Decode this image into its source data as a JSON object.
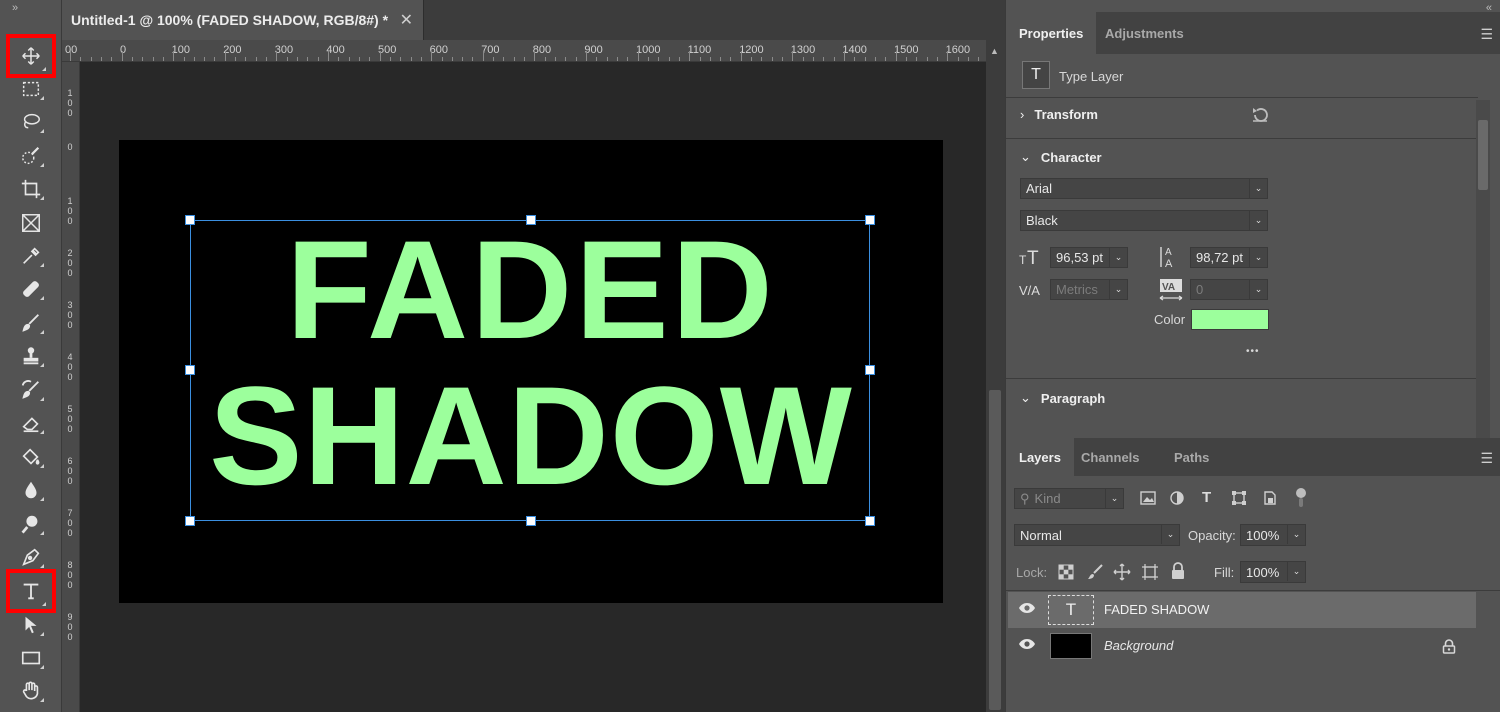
{
  "document": {
    "tab_title": "Untitled-1 @ 100% (FADED SHADOW, RGB/8#) *",
    "close_glyph": "✕",
    "ruler_top": [
      "00",
      "0",
      "100",
      "200",
      "300",
      "400",
      "500",
      "600",
      "700",
      "800",
      "900",
      "1000",
      "1100",
      "1200",
      "1300",
      "1400",
      "1500",
      "1600"
    ],
    "ruler_left": [
      "1 0 0",
      "0",
      "1 0 0",
      "2 0 0",
      "3 0 0",
      "4 0 0",
      "5 0 0",
      "6 0 0",
      "7 0 0",
      "8 0 0",
      "9 0 0"
    ],
    "text_line1": "FADED",
    "text_line2": "SHADOW",
    "text_color": "#9cff9c",
    "selection_color": "#3b8fe0"
  },
  "toolbar": {
    "collapse": "»",
    "highlight_color": "#ff0000",
    "tools": [
      {
        "name": "move-tool",
        "icon": "move-icon",
        "highlighted": true
      },
      {
        "name": "marquee-tool",
        "icon": "marquee-icon"
      },
      {
        "name": "lasso-tool",
        "icon": "lasso-icon"
      },
      {
        "name": "quick-selection-tool",
        "icon": "quick-selection-icon"
      },
      {
        "name": "crop-tool",
        "icon": "crop-icon"
      },
      {
        "name": "frame-tool",
        "icon": "frame-icon"
      },
      {
        "name": "eyedropper-tool",
        "icon": "eyedropper-icon"
      },
      {
        "name": "healing-tool",
        "icon": "bandage-icon"
      },
      {
        "name": "brush-tool",
        "icon": "brush-icon"
      },
      {
        "name": "stamp-tool",
        "icon": "stamp-icon"
      },
      {
        "name": "history-brush-tool",
        "icon": "history-brush-icon"
      },
      {
        "name": "eraser-tool",
        "icon": "eraser-icon"
      },
      {
        "name": "paint-bucket-tool",
        "icon": "paint-bucket-icon"
      },
      {
        "name": "blur-tool",
        "icon": "drop-icon"
      },
      {
        "name": "dodge-tool",
        "icon": "dodge-icon"
      },
      {
        "name": "pen-tool",
        "icon": "pen-icon"
      },
      {
        "name": "type-tool",
        "icon": "type-icon",
        "highlighted": true
      },
      {
        "name": "path-selection-tool",
        "icon": "arrow-icon"
      },
      {
        "name": "rectangle-tool",
        "icon": "rectangle-icon"
      },
      {
        "name": "hand-tool",
        "icon": "hand-icon"
      }
    ]
  },
  "properties": {
    "tabs": [
      {
        "label": "Properties",
        "active": true
      },
      {
        "label": "Adjustments",
        "active": false
      }
    ],
    "layer_kind": "Type Layer",
    "transform_label": "Transform",
    "character_label": "Character",
    "font_family": "Arial",
    "font_style": "Black",
    "font_size": "96,53 pt",
    "leading": "98,72 pt",
    "kerning": "Metrics",
    "tracking": "0",
    "color_label": "Color",
    "color_swatch": "#9cff9c",
    "more": "•••",
    "paragraph_label": "Paragraph"
  },
  "layers": {
    "tabs": [
      {
        "label": "Layers",
        "active": true
      },
      {
        "label": "Channels",
        "active": false
      },
      {
        "label": "Paths",
        "active": false
      }
    ],
    "filter_placeholder": "Kind",
    "blend_mode": "Normal",
    "opacity_label": "Opacity:",
    "opacity_value": "100%",
    "lock_label": "Lock:",
    "fill_label": "Fill:",
    "fill_value": "100%",
    "items": [
      {
        "name": "FADED SHADOW",
        "type": "text",
        "selected": true
      },
      {
        "name": "Background",
        "type": "image",
        "locked": true
      }
    ]
  }
}
